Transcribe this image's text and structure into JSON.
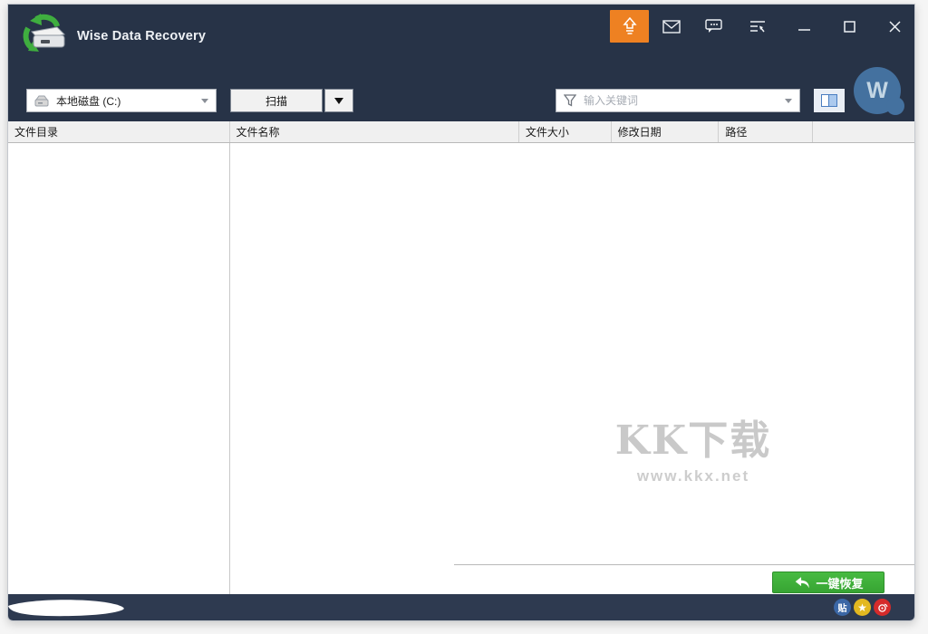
{
  "app": {
    "title": "Wise Data Recovery"
  },
  "toolbar": {
    "drive_selector_value": "本地磁盘 (C:)",
    "scan_label": "扫描",
    "search_placeholder": "输入关键词",
    "avatar_letter": "W"
  },
  "table": {
    "columns": [
      {
        "label": "文件目录"
      },
      {
        "label": "文件名称"
      },
      {
        "label": "文件大小"
      },
      {
        "label": "修改日期"
      },
      {
        "label": "路径"
      },
      {
        "label": ""
      }
    ]
  },
  "watermark": {
    "text": "KK下载",
    "url": "www.kkx.net"
  },
  "actions": {
    "recover_label": "一键恢复"
  },
  "statusbar": {
    "social": [
      {
        "name": "tieba",
        "glyph": "贴",
        "color": "#3b67a6"
      },
      {
        "name": "qzone",
        "glyph": "★",
        "color": "#e3b820"
      },
      {
        "name": "weibo",
        "color": "#d52b2b"
      }
    ]
  },
  "colors": {
    "accent_orange": "#ee8122",
    "recover_green": "#3cae3a",
    "avatar_blue": "#44719f",
    "header_bg": "#273347",
    "statusbar_bg": "#2e3a50"
  }
}
